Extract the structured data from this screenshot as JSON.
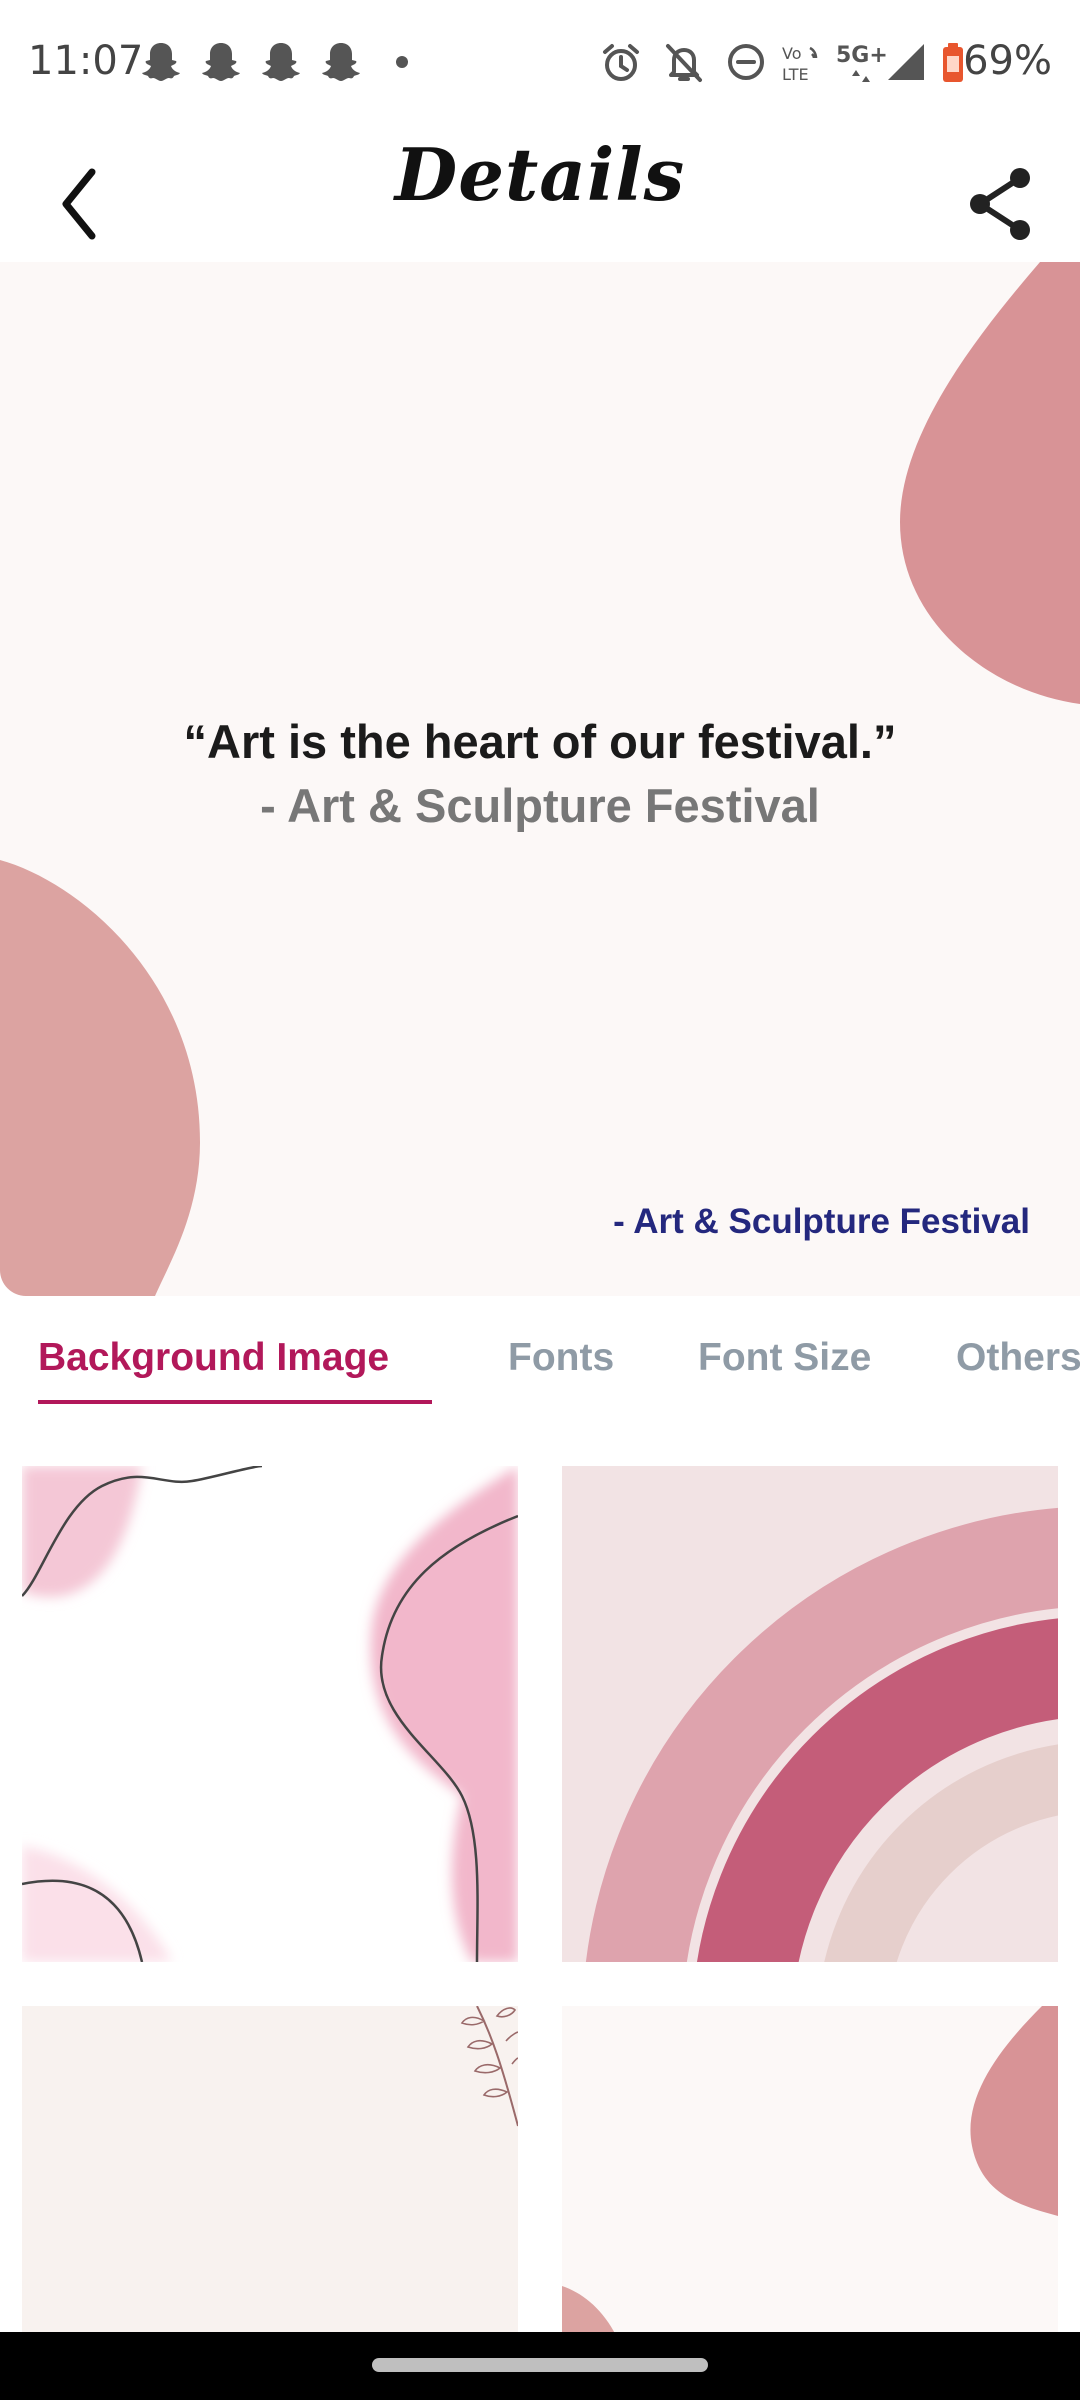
{
  "status_bar": {
    "time": "11:07",
    "battery_percent": "69%",
    "icons": [
      "snapchat-icon",
      "snapchat-icon",
      "snapchat-icon",
      "snapchat-icon",
      "alarm-icon",
      "bell-off-icon",
      "do-not-disturb-icon",
      "volte-icon",
      "5g-icon",
      "signal-icon",
      "battery-icon"
    ],
    "network_labels": {
      "volte_top": "Vo",
      "volte_bottom": "LTE",
      "net_type": "5G+"
    }
  },
  "app_bar": {
    "title": "Details",
    "back_icon": "back-arrow-icon",
    "share_icon": "share-icon"
  },
  "preview": {
    "quote": "“Art is the heart of our festival.”",
    "author": "- Art & Sculpture Festival",
    "watermark": "- Art & Sculpture Festival",
    "colors": {
      "background": "#fcf8f7",
      "shape": "#d89396",
      "quote": "#1b1b1b",
      "author": "#777777",
      "watermark": "#24287e"
    }
  },
  "tabs": {
    "items": [
      {
        "label": "Background Image",
        "active": true
      },
      {
        "label": "Fonts",
        "active": false
      },
      {
        "label": "Font Size",
        "active": false
      },
      {
        "label": "Others",
        "active": false
      }
    ],
    "colors": {
      "active": "#b2185a",
      "inactive": "#8f9ba6"
    }
  },
  "backgrounds": {
    "options": [
      "pink-blobs-line",
      "rose-arches",
      "beige-leaves",
      "rose-blobs"
    ]
  }
}
